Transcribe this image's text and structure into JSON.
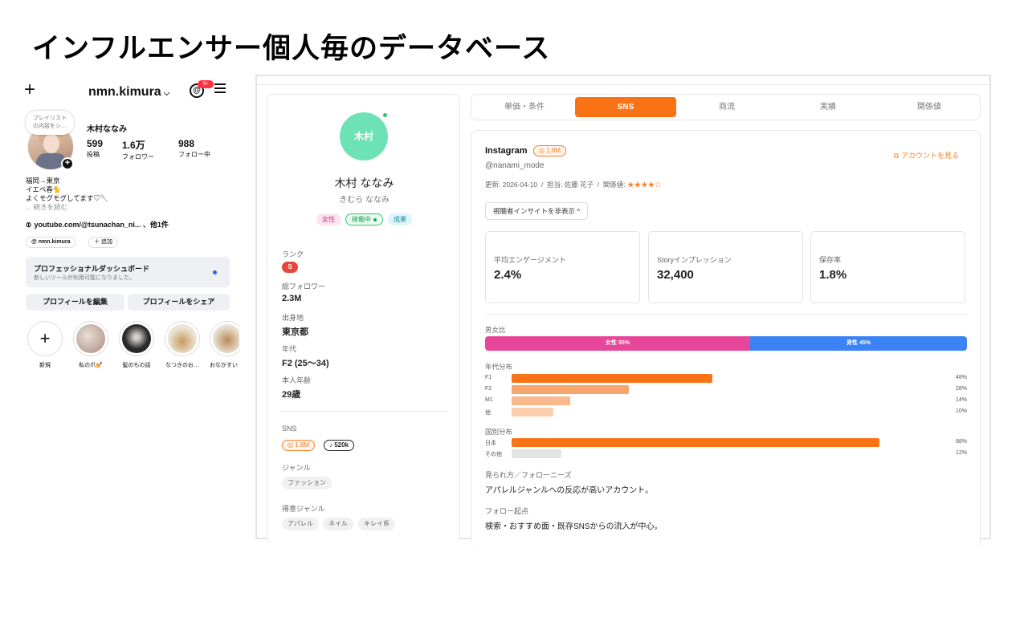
{
  "page_title": "インフルエンサー個人毎のデータベース",
  "instagram": {
    "plus_icon": "plus-icon",
    "username": "nmn.kimura",
    "notification_count": "9+",
    "bubble_text": "プレイリスト\nの内容をシ…",
    "display_name": "木村ななみ",
    "stats": [
      {
        "num": "599",
        "label": "投稿"
      },
      {
        "num": "1.6万",
        "label": "フォロワー"
      },
      {
        "num": "988",
        "label": "フォロー中"
      }
    ],
    "bio_lines": [
      "福岡→東京",
      "イエベ春🐈",
      "よくモグモグしてます♡🥄"
    ],
    "bio_more": "... 続きを読む",
    "link_text": "youtube.com/@tsunachan_ni... 、他1件",
    "threads_chip": "nmn.kimura",
    "add_chip": "＋ 追加",
    "dashboard_title": "プロフェッショナルダッシュボード",
    "dashboard_sub": "新しいツールが利用可能になりました。",
    "edit_button": "プロフィールを編集",
    "share_button": "プロフィールをシェア",
    "highlights": [
      {
        "label": "新規",
        "color": "#ffffff"
      },
      {
        "label": "私の爪💅",
        "color": "#c9b6ab"
      },
      {
        "label": "髪のもの話",
        "color": "#3c3a3b"
      },
      {
        "label": "なつきのお…",
        "color": "#d9cbb4"
      },
      {
        "label": "おなかすい",
        "color": "#cbb79a"
      }
    ]
  },
  "profile": {
    "avatar_text": "木村",
    "name": "木村 ななみ",
    "kana": "きむら ななみ",
    "tags": {
      "gender": "女性",
      "status": "稼働中",
      "result": "成果"
    },
    "rank_label": "ランク",
    "rank": "S",
    "followers_label": "総フォロワー",
    "followers": "2.3M",
    "birthplace_label": "出身地",
    "birthplace": "東京都",
    "age_group_label": "年代",
    "age_group": "F2 (25〜34)",
    "age_label": "本人年齢",
    "age": "29歳",
    "sns_label": "SNS",
    "sns_instagram": "1.8M",
    "sns_tiktok": "520k",
    "genre_label": "ジャンル",
    "genre": "ファッション",
    "strong_genre_label": "得意ジャンル",
    "strong_genres": [
      "アパレル",
      "ネイル",
      "キレイ系"
    ]
  },
  "tabs": [
    "単価・条件",
    "SNS",
    "商流",
    "実績",
    "関係値"
  ],
  "active_tab": "SNS",
  "detail": {
    "platform": "Instagram",
    "platform_followers": "1.8M",
    "handle": "@nanami_mode",
    "meta_prefix": "更新: 2026-04-10  /  担当: 佐藤 花子  /  関係値: ",
    "stars": "★★★★☆",
    "account_link": "アカウントを見る",
    "toggle_label": "視聴者インサイトを非表示 ^",
    "kpis": [
      {
        "label": "平均エンゲージメント",
        "value": "2.4%"
      },
      {
        "label": "Storyインプレッション",
        "value": "32,400"
      },
      {
        "label": "保存率",
        "value": "1.8%"
      }
    ],
    "gender_label": "男女比",
    "gender": [
      {
        "label": "女性 55%",
        "pct": 55,
        "color": "#e8469a"
      },
      {
        "label": "男性 45%",
        "pct": 45,
        "color": "#3b82f6"
      }
    ],
    "age_label": "年代分布",
    "age_dist": [
      {
        "label": "F1",
        "pct": 48,
        "pct_text": "48%",
        "color": "#f97316"
      },
      {
        "label": "F2",
        "pct": 28,
        "pct_text": "28%",
        "color": "#f7a46d"
      },
      {
        "label": "M1",
        "pct": 14,
        "pct_text": "14%",
        "color": "#f9b98d"
      },
      {
        "label": "他",
        "pct": 10,
        "pct_text": "10%",
        "color": "#fbcfae"
      }
    ],
    "country_label": "国別分布",
    "country_dist": [
      {
        "label": "日本",
        "pct": 88,
        "pct_text": "88%",
        "color": "#f97316"
      },
      {
        "label": "その他",
        "pct": 12,
        "pct_text": "12%",
        "color": "#e4e4e4"
      }
    ],
    "needs_label": "見られ方／フォロ一ニーズ",
    "needs_text": "アパレルジャンルへの反応が高いアカウント。",
    "origin_label": "フォロー起点",
    "origin_text": "検索・おすすめ面・既存SNSからの流入が中心。"
  }
}
